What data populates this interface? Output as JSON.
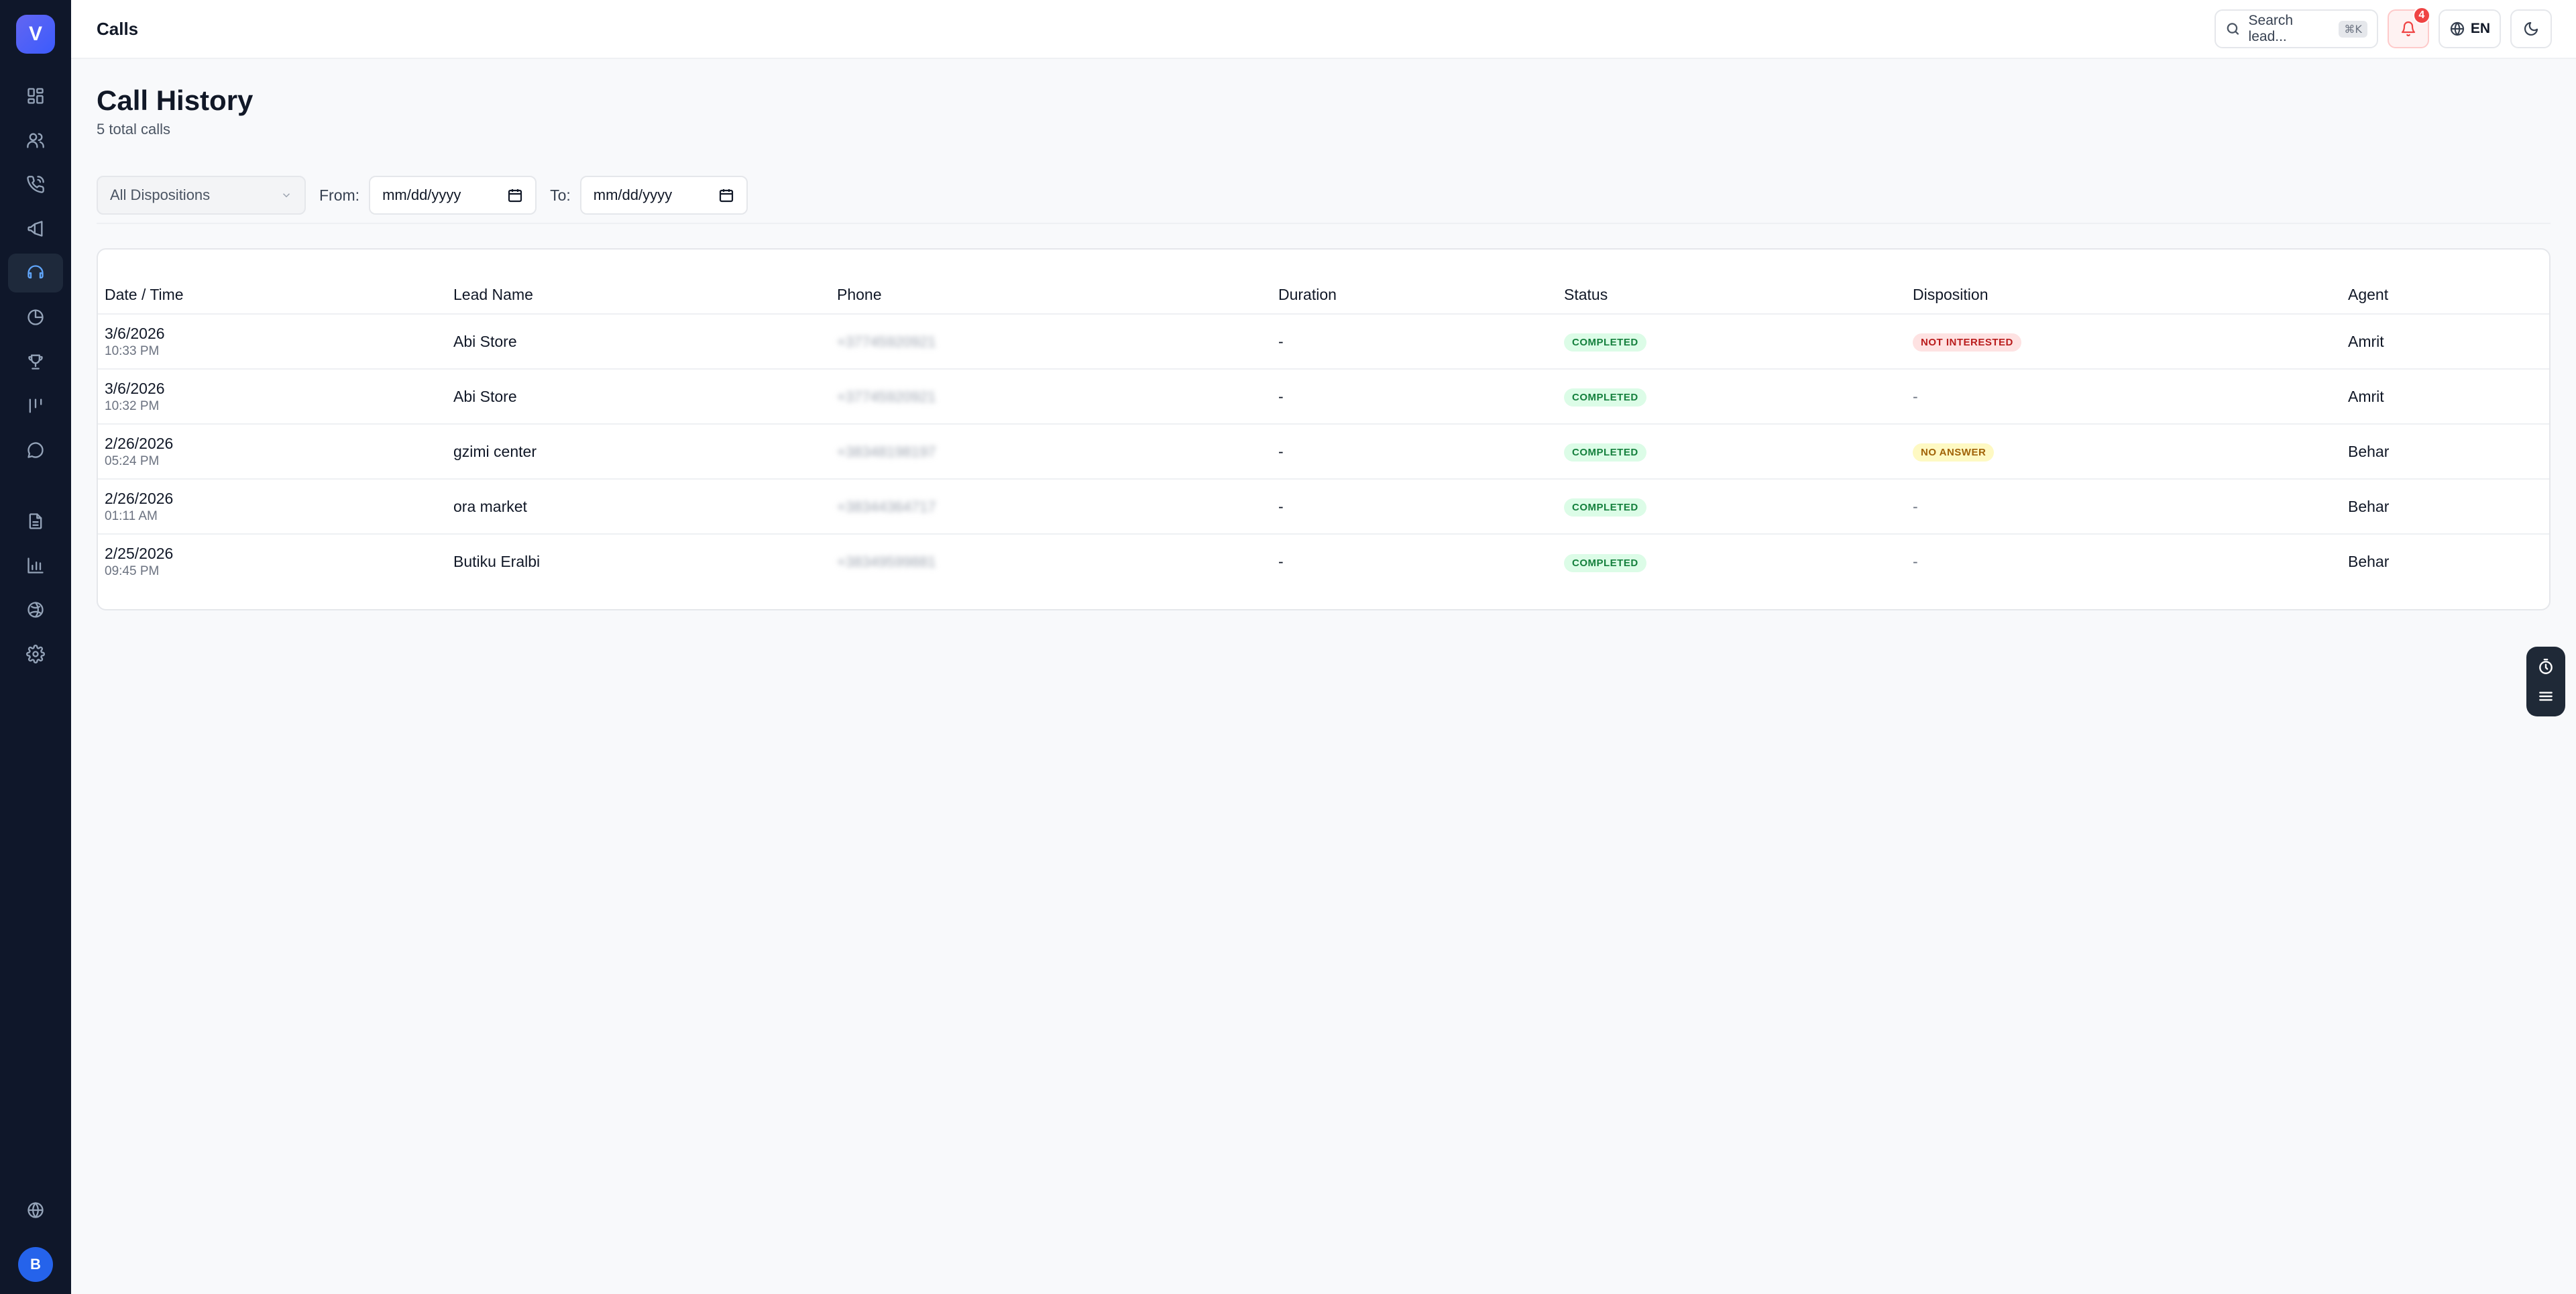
{
  "app": {
    "logo_letter": "V",
    "user_initial": "B"
  },
  "header": {
    "title": "Calls",
    "search_placeholder": "Search lead...",
    "search_shortcut": "⌘K",
    "notifications_count": "4",
    "language": "EN"
  },
  "sidebar": {
    "items": [
      {
        "icon": "dashboard-icon"
      },
      {
        "icon": "users-icon"
      },
      {
        "icon": "phone-icon"
      },
      {
        "icon": "megaphone-icon"
      },
      {
        "icon": "headset-icon",
        "active": true
      },
      {
        "icon": "clock-icon"
      },
      {
        "icon": "trophy-icon"
      },
      {
        "icon": "pipeline-icon"
      },
      {
        "icon": "chat-icon"
      },
      {
        "icon": "document-icon"
      },
      {
        "icon": "bar-chart-icon"
      },
      {
        "icon": "globe-alt-icon"
      },
      {
        "icon": "settings-icon"
      }
    ]
  },
  "page": {
    "title": "Call History",
    "subtitle": "5 total calls"
  },
  "filters": {
    "disposition": "All Dispositions",
    "from_label": "From:",
    "from_value": "mm/dd/yyyy",
    "to_label": "To:",
    "to_value": "mm/dd/yyyy"
  },
  "table": {
    "headers": [
      "Date / Time",
      "Lead Name",
      "Phone",
      "Duration",
      "Status",
      "Disposition",
      "Agent"
    ],
    "rows": [
      {
        "date": "3/6/2026",
        "time": "10:33 PM",
        "lead": "Abi Store",
        "phone": "+37745920921",
        "duration": "-",
        "status": "COMPLETED",
        "disposition": "NOT INTERESTED",
        "agent": "Amrit"
      },
      {
        "date": "3/6/2026",
        "time": "10:32 PM",
        "lead": "Abi Store",
        "phone": "+37745920921",
        "duration": "-",
        "status": "COMPLETED",
        "disposition": "-",
        "agent": "Amrit"
      },
      {
        "date": "2/26/2026",
        "time": "05:24 PM",
        "lead": "gzimi center",
        "phone": "+38348198197",
        "duration": "-",
        "status": "COMPLETED",
        "disposition": "NO ANSWER",
        "agent": "Behar"
      },
      {
        "date": "2/26/2026",
        "time": "01:11 AM",
        "lead": "ora market",
        "phone": "+38344364717",
        "duration": "-",
        "status": "COMPLETED",
        "disposition": "-",
        "agent": "Behar"
      },
      {
        "date": "2/25/2026",
        "time": "09:45 PM",
        "lead": "Butiku Eralbi",
        "phone": "+38349599881",
        "duration": "-",
        "status": "COMPLETED",
        "disposition": "-",
        "agent": "Behar"
      }
    ]
  }
}
